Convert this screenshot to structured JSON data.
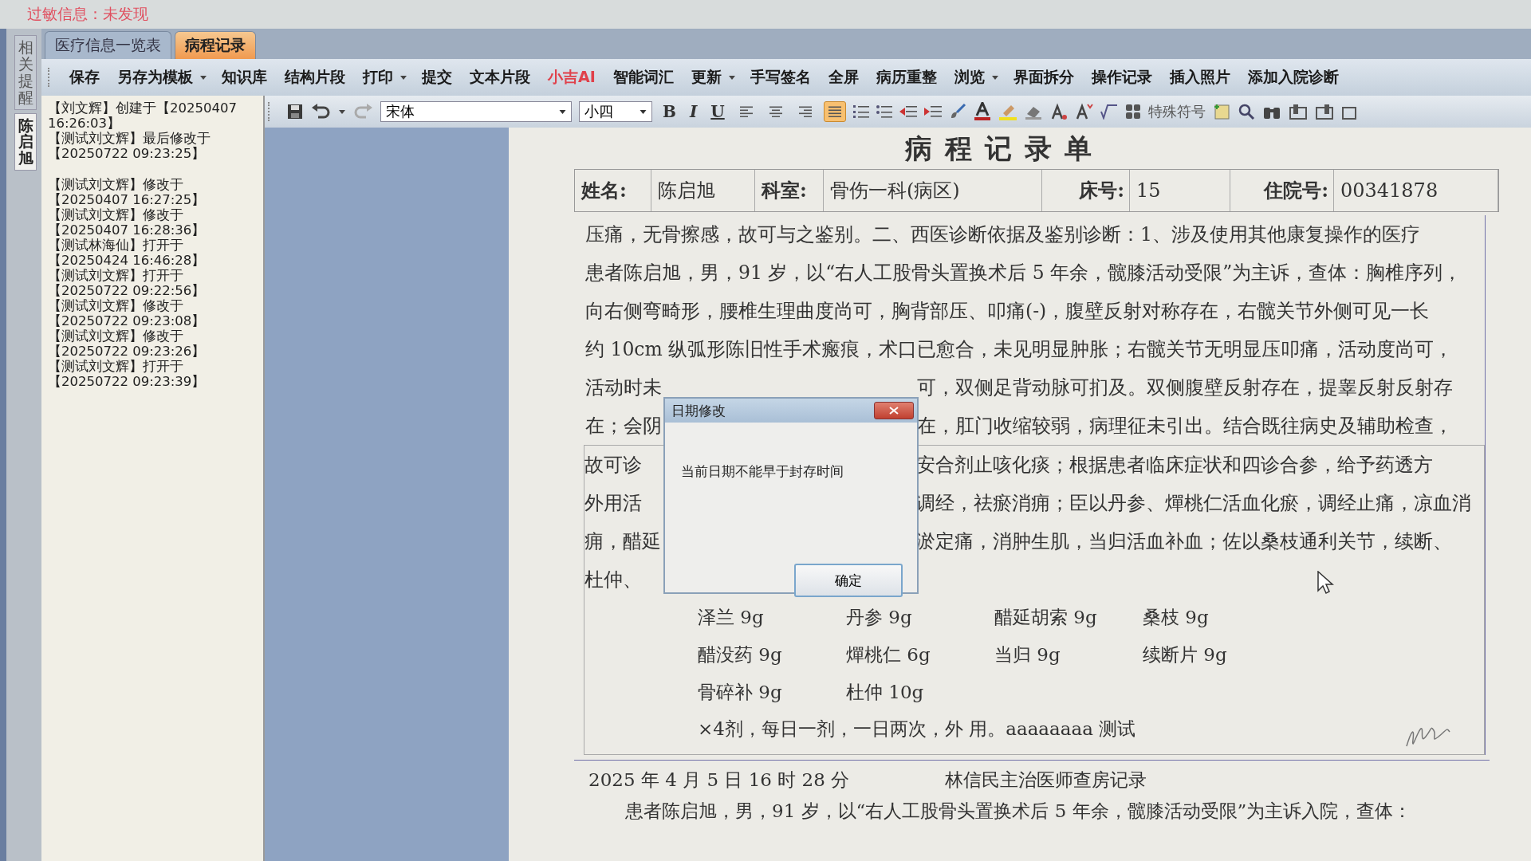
{
  "allergy_info": "过敏信息：未发现",
  "side_tabs": [
    {
      "label": "相关提醒",
      "selected": false
    },
    {
      "label": "陈启旭",
      "selected": true
    }
  ],
  "tabs": [
    {
      "label": "医疗信息一览表",
      "selected": false
    },
    {
      "label": "病程记录",
      "selected": true
    }
  ],
  "menu": [
    {
      "label": "保存",
      "dropdown": false,
      "color": "#1a1a1a"
    },
    {
      "label": "另存为模板",
      "dropdown": true,
      "color": "#1a1a1a"
    },
    {
      "label": "知识库",
      "dropdown": false,
      "color": "#1a1a1a"
    },
    {
      "label": "结构片段",
      "dropdown": false,
      "color": "#1a1a1a"
    },
    {
      "label": "打印",
      "dropdown": true,
      "color": "#1a1a1a"
    },
    {
      "label": "提交",
      "dropdown": false,
      "color": "#1a1a1a"
    },
    {
      "label": "文本片段",
      "dropdown": false,
      "color": "#1a1a1a"
    },
    {
      "label": "小吉AI",
      "dropdown": false,
      "color": "#e0404a"
    },
    {
      "label": "智能词汇",
      "dropdown": false,
      "color": "#1a1a1a"
    },
    {
      "label": "更新",
      "dropdown": true,
      "color": "#1a1a1a"
    },
    {
      "label": "手写签名",
      "dropdown": false,
      "color": "#1a1a1a"
    },
    {
      "label": "全屏",
      "dropdown": false,
      "color": "#1a1a1a"
    },
    {
      "label": "病历重整",
      "dropdown": false,
      "color": "#1a1a1a"
    },
    {
      "label": "浏览",
      "dropdown": true,
      "color": "#1a1a1a"
    },
    {
      "label": "界面拆分",
      "dropdown": false,
      "color": "#1a1a1a"
    },
    {
      "label": "操作记录",
      "dropdown": false,
      "color": "#1a1a1a"
    },
    {
      "label": "插入照片",
      "dropdown": false,
      "color": "#1a1a1a"
    },
    {
      "label": "添加入院诊断",
      "dropdown": false,
      "color": "#1a1a1a"
    }
  ],
  "log_summary": [
    "【刘文辉】创建于【20250407 16:26:03】",
    "【测试刘文辉】最后修改于【20250722 09:23:25】"
  ],
  "log_history": [
    "【测试刘文辉】修改于【20250407 16:27:25】",
    "【测试刘文辉】修改于【20250407 16:28:36】",
    "【测试林海仙】打开于【20250424 16:46:28】",
    "【测试刘文辉】打开于【20250722 09:22:56】",
    "【测试刘文辉】修改于【20250722 09:23:08】",
    "【测试刘文辉】修改于【20250722 09:23:26】",
    "【测试刘文辉】打开于【20250722 09:23:39】"
  ],
  "format_toolbar": {
    "font": "宋体",
    "size": "小四",
    "style_buttons": [
      "B",
      "I",
      "U"
    ],
    "align_buttons": [
      {
        "selected": false
      },
      {
        "selected": false
      },
      {
        "selected": false
      },
      {
        "selected": true
      }
    ],
    "special_symbols": "特殊符号"
  },
  "document": {
    "title": "病程记录单",
    "info": [
      {
        "label": "姓名:",
        "value": "陈启旭"
      },
      {
        "label": "科室:",
        "value": "骨伤一科(病区)"
      },
      {
        "label": "床号:",
        "value": "15"
      },
      {
        "label": "住院号:",
        "value": "00341878"
      }
    ],
    "record_lines": [
      {
        "kind": "full",
        "text": "压痛，无骨擦感，故可与之鉴别。二、西医诊断依据及鉴别诊断：1、涉及使用其他康复操作的医疗"
      },
      {
        "kind": "full",
        "text": "患者陈启旭，男，91 岁，以“右人工股骨头置换术后 5 年余，髋膝活动受限”为主诉，查体：胸椎序列，"
      },
      {
        "kind": "full",
        "text": "向右侧弯畸形，腰椎生理曲度尚可，胸背部压、叩痛(-)，腹壁反射对称存在，右髋关节外侧可见一长"
      },
      {
        "kind": "full",
        "text": "约 10cm 纵弧形陈旧性手术瘢痕，术口已愈合，未见明显肿胀；右髋关节无明显压叩痛，活动度尚可，"
      },
      {
        "kind": "split",
        "left": "活动时未",
        "right": "可，双侧足背动脉可扪及。双侧腹壁反射存在，提睾反射反射存"
      },
      {
        "kind": "split",
        "left": "在；会阴",
        "right": "在，肛门收缩较弱，病理征未引出。结合既往病史及辅助检查，"
      }
    ],
    "prescription_lines": [
      {
        "kind": "split",
        "left": "故可诊",
        "right": "安合剂止咳化痰；根据患者临床症状和四诊合参，给予药透方"
      },
      {
        "kind": "split",
        "left": "外用活",
        "right": "调经，祛瘀消痈；臣以丹参、燀桃仁活血化瘀，调经止痛，凉血消"
      },
      {
        "kind": "split",
        "left": "痈，醋延",
        "right": "淤定痛，消肿生肌，当归活血补血；佐以桑枝通利关节，续断、"
      },
      {
        "kind": "split",
        "left": "杜仲、"
      }
    ],
    "herbs": [
      "泽兰 9g",
      "丹参 9g",
      "醋延胡索 9g",
      "桑枝 9g",
      "醋没药 9g",
      "燀桃仁 6g",
      "当归 9g",
      "续断片 9g",
      "骨碎补 9g",
      "杜仲 10g"
    ],
    "dosage": "×4剂，每日一剂，一日两次，外 用。aaaaaaaa 测试",
    "next_date": "2025 年 4 月 5 日 16 时 28 分",
    "next_title": "林信民主治医师查房记录",
    "next_text": "患者陈启旭，男，91 岁，以“右人工股骨头置换术后 5 年余，髋膝活动受限”为主诉入院，查体："
  },
  "dialog": {
    "title": "日期修改",
    "message": "当前日期不能早于封存时间",
    "button": "确定"
  }
}
